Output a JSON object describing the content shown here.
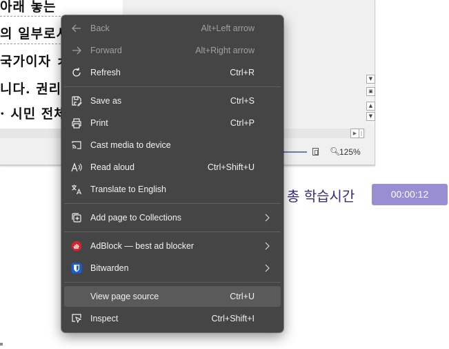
{
  "document": {
    "lines": [
      "아래 놓는",
      "의 일부로서",
      "국가이자 ㅊ",
      "니다. 권리이",
      "· 시민 전체"
    ],
    "zoom": "125%"
  },
  "study": {
    "label": "총 학습시간",
    "timer": "00:00:12"
  },
  "menu": {
    "items": [
      {
        "label": "Back",
        "shortcut": "Alt+Left arrow",
        "icon": "back-arrow-icon",
        "disabled": true
      },
      {
        "label": "Forward",
        "shortcut": "Alt+Right arrow",
        "icon": "forward-arrow-icon",
        "disabled": true
      },
      {
        "label": "Refresh",
        "shortcut": "Ctrl+R",
        "icon": "refresh-icon"
      },
      {
        "label": "Save as",
        "shortcut": "Ctrl+S",
        "icon": "save-as-icon"
      },
      {
        "label": "Print",
        "shortcut": "Ctrl+P",
        "icon": "printer-icon"
      },
      {
        "label": "Cast media to device",
        "shortcut": "",
        "icon": "cast-icon"
      },
      {
        "label": "Read aloud",
        "shortcut": "Ctrl+Shift+U",
        "icon": "read-aloud-icon"
      },
      {
        "label": "Translate to English",
        "shortcut": "",
        "icon": "translate-icon"
      },
      {
        "label": "Add page to Collections",
        "shortcut": "",
        "icon": "collections-icon",
        "submenu": true
      },
      {
        "label": "AdBlock — best ad blocker",
        "shortcut": "",
        "icon": "adblock-icon",
        "submenu": true
      },
      {
        "label": "Bitwarden",
        "shortcut": "",
        "icon": "bitwarden-icon",
        "submenu": true
      },
      {
        "label": "View page source",
        "shortcut": "Ctrl+U",
        "icon": "",
        "highlighted": true
      },
      {
        "label": "Inspect",
        "shortcut": "Ctrl+Shift+I",
        "icon": "inspect-icon"
      }
    ]
  },
  "colors": {
    "menu_bg": "#454545",
    "highlight": "#5a5a5a",
    "timer_bg": "#9a8ed2",
    "study_text": "#3b2a7c",
    "adblock_red": "#d6242c",
    "bitwarden_blue": "#175ddc"
  }
}
